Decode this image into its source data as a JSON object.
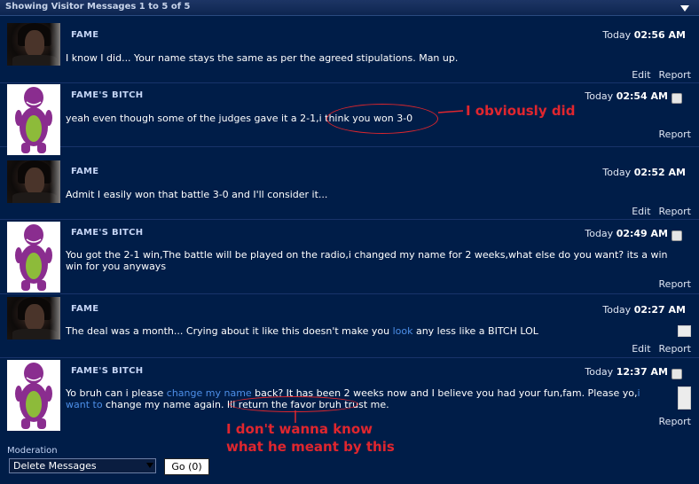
{
  "header": {
    "title": "Showing Visitor Messages 1 to 5 of 5"
  },
  "messages": [
    {
      "author": "FAME",
      "date": "Today",
      "time": "02:56 AM",
      "body": "I know I did... Your name stays the same as per the agreed stipulations. Man up.",
      "actions": [
        "Edit",
        "Report"
      ]
    },
    {
      "author": "FAME'S BITCH",
      "date": "Today",
      "time": "02:54 AM",
      "body": "yeah even though some of the judges gave it a 2-1,i think you won 3-0",
      "actions": [
        "Report"
      ]
    },
    {
      "author": "FAME",
      "date": "Today",
      "time": "02:52 AM",
      "body": "Admit I easily won that battle 3-0 and I'll consider it...",
      "actions": [
        "Edit",
        "Report"
      ]
    },
    {
      "author": "FAME'S BITCH",
      "date": "Today",
      "time": "02:49 AM",
      "body_line1": "You got the 2-1 win,The battle will be played on the radio,i changed my name for 2 weeks,what else do you want? its a win",
      "body_line2": "win for you anyways",
      "actions": [
        "Report"
      ]
    },
    {
      "author": "FAME",
      "date": "Today",
      "time": "02:27 AM",
      "body_pre": "The deal was a month... Crying about it like this doesn't make you ",
      "body_link": "look",
      "body_post": " any less like a BITCH LOL",
      "actions": [
        "Edit",
        "Report"
      ]
    },
    {
      "author": "FAME'S BITCH",
      "date": "Today",
      "time": "12:37 AM",
      "body_a": "Yo bruh can i please ",
      "body_link1": "change my name",
      "body_b": " back? It has been 2 weeks now and I believe you had your fun,fam. Please yo,",
      "body_link2a": "i",
      "body_link2b": "want to",
      "body_c": " change my name again. Ill return the favor bruh trust me.",
      "actions": [
        "Report"
      ]
    }
  ],
  "annotations": {
    "note1": "I obviously did",
    "note2_line1": "I don't wanna know",
    "note2_line2": "what he meant by this",
    "color": "#e0262e"
  },
  "moderation": {
    "label": "Moderation",
    "selected": "Delete Messages",
    "go_label": "Go (0)"
  },
  "colors": {
    "background": "#001d48",
    "author": "#c5d5f5",
    "link": "#4d8fe8"
  }
}
